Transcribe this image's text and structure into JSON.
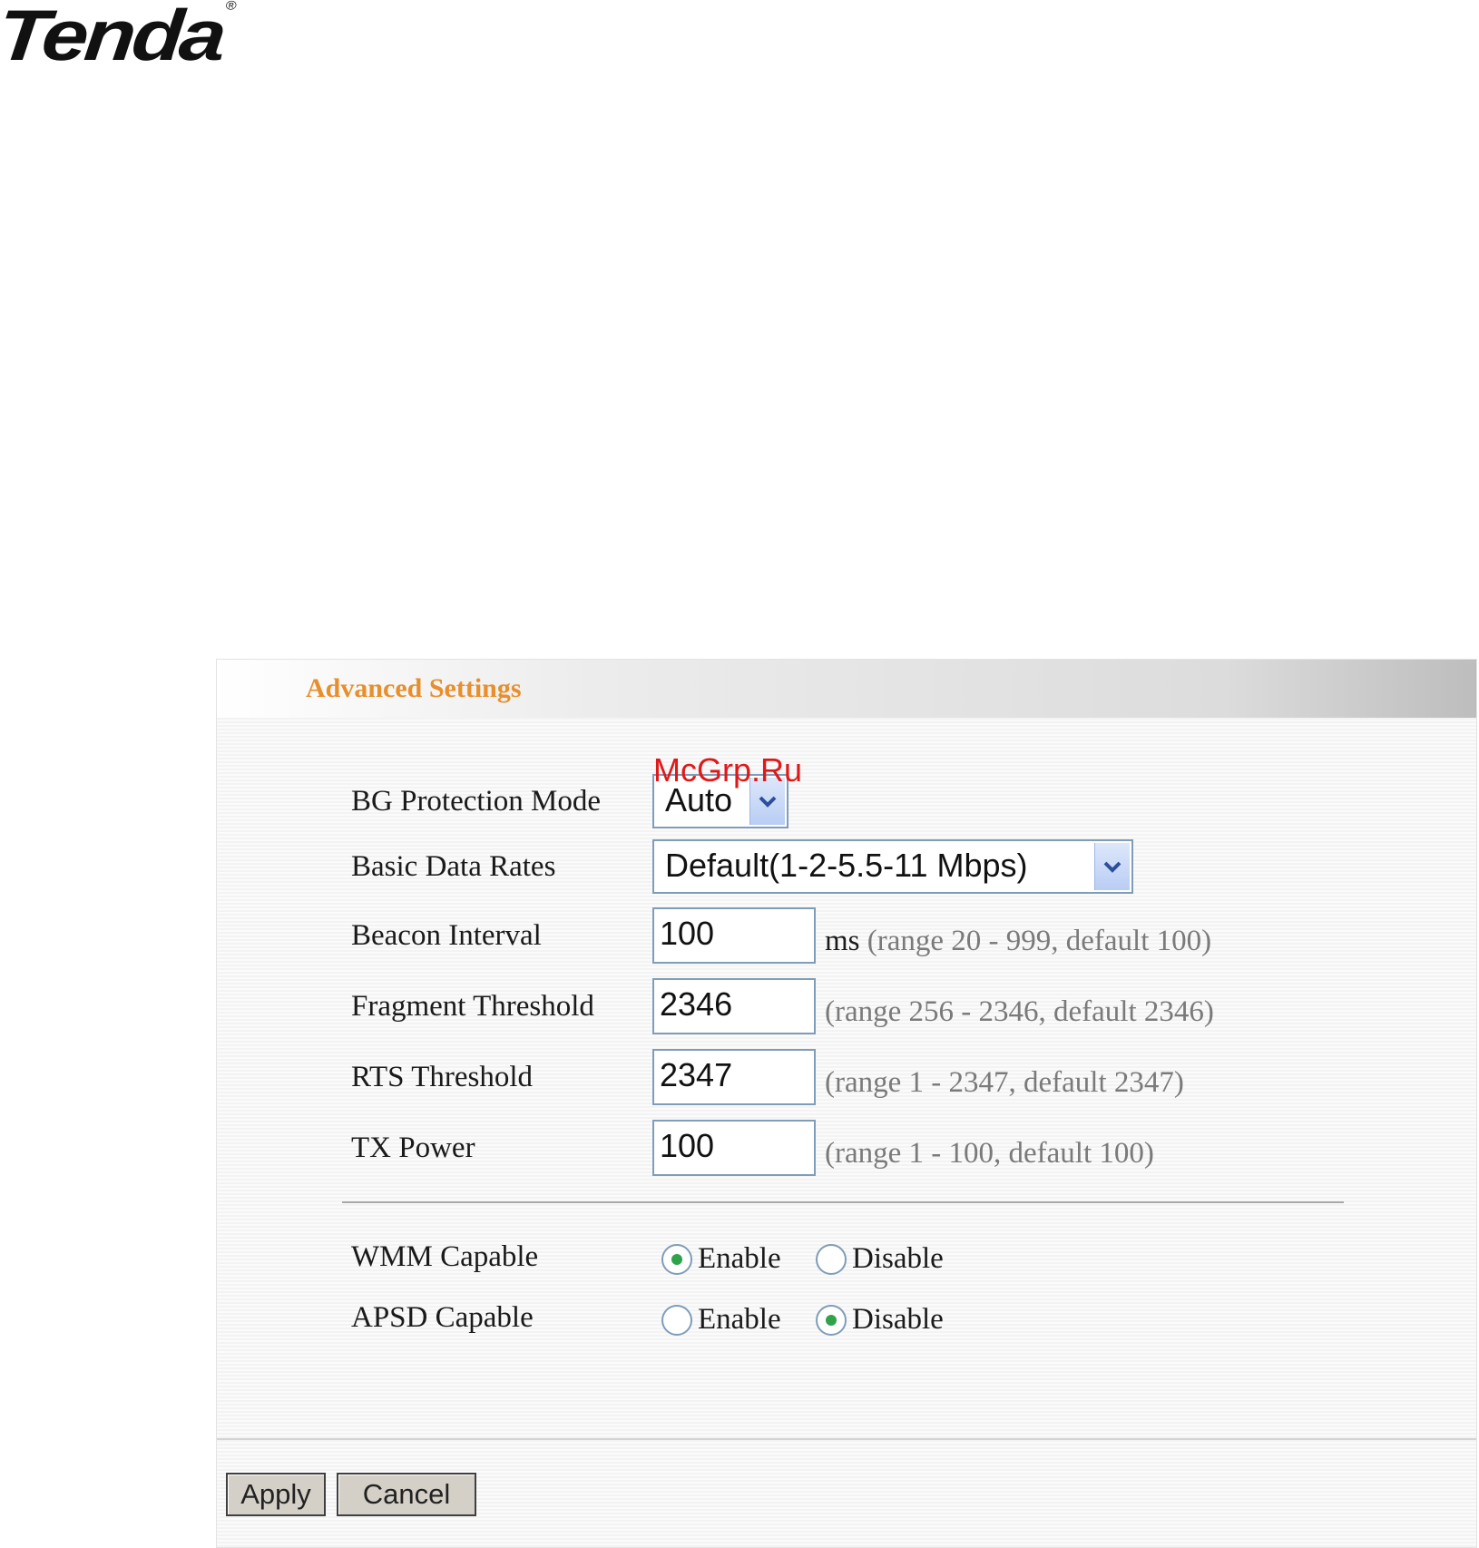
{
  "logo": {
    "text": "Tenda",
    "mark": "®"
  },
  "panel": {
    "title": "Advanced Settings"
  },
  "fields": {
    "bg_protection": {
      "label": "BG Protection Mode",
      "value": "Auto"
    },
    "basic_rates": {
      "label": "Basic Data Rates",
      "value": "Default(1-2-5.5-11 Mbps)"
    },
    "beacon": {
      "label": "Beacon Interval",
      "value": "100",
      "unit": "ms",
      "hint": "(range 20 - 999, default 100)"
    },
    "fragment": {
      "label": "Fragment Threshold",
      "value": "2346",
      "hint": "(range 256 - 2346, default 2346)"
    },
    "rts": {
      "label": "RTS Threshold",
      "value": "2347",
      "hint": "(range 1 - 2347, default 2347)"
    },
    "tx_power": {
      "label": "TX Power",
      "value": "100",
      "hint": "(range 1 - 100, default 100)"
    }
  },
  "radios": {
    "wmm": {
      "label": "WMM Capable",
      "enable": "Enable",
      "disable": "Disable",
      "selected": "Enable"
    },
    "apsd": {
      "label": "APSD Capable",
      "enable": "Enable",
      "disable": "Disable",
      "selected": "Disable"
    }
  },
  "buttons": {
    "apply": "Apply",
    "cancel": "Cancel"
  },
  "watermark": "McGrp.Ru",
  "colors": {
    "title": "#e88f2c",
    "watermark": "#e01818",
    "radio_dot": "#2fa34a",
    "input_border": "#7f9db9"
  },
  "icons": {
    "dropdown": "chevron-down-icon"
  }
}
